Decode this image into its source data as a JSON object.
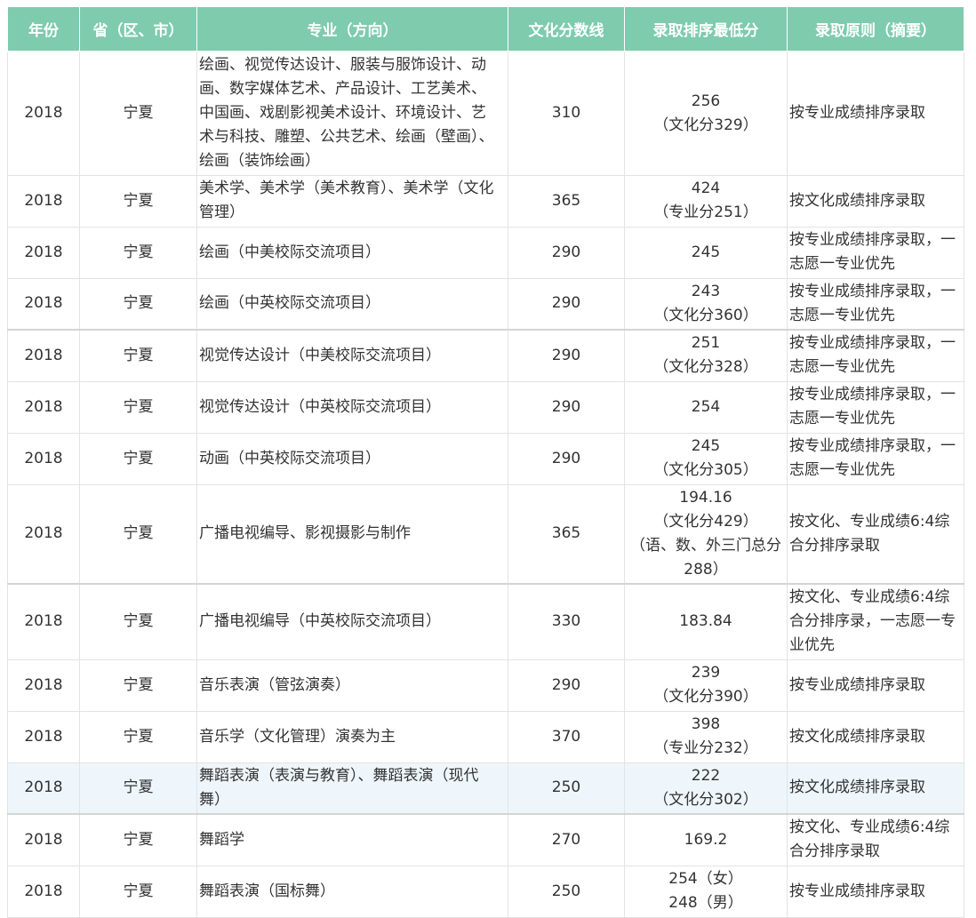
{
  "table": {
    "headers": [
      "年份",
      "省（区、市）",
      "专业（方向）",
      "文化分数线",
      "录取排序最低分",
      "录取原则（摘要）"
    ],
    "rows": [
      {
        "year": "2018",
        "province": "宁夏",
        "major": "绘画、视觉传达设计、服装与服饰设计、动画、数字媒体艺术、产品设计、工艺美术、中国画、戏剧影视美术设计、环境设计、艺术与科技、雕塑、公共艺术、绘画（壁画）、绘画（装饰绘画）",
        "culture_line": "310",
        "min_score": [
          "256",
          "（文化分329）"
        ],
        "principle": "按专业成绩排序录取"
      },
      {
        "year": "2018",
        "province": "宁夏",
        "major": "美术学、美术学（美术教育）、美术学（文化管理）",
        "culture_line": "365",
        "min_score": [
          "424",
          "（专业分251）"
        ],
        "principle": "按文化成绩排序录取"
      },
      {
        "year": "2018",
        "province": "宁夏",
        "major": "绘画（中美校际交流项目）",
        "culture_line": "290",
        "min_score": [
          "245"
        ],
        "principle": "按专业成绩排序录取，一志愿一专业优先"
      },
      {
        "year": "2018",
        "province": "宁夏",
        "major": "绘画（中英校际交流项目）",
        "culture_line": "290",
        "min_score": [
          "243",
          "（文化分360）"
        ],
        "principle": "按专业成绩排序录取，一志愿一专业优先"
      },
      {
        "year": "2018",
        "province": "宁夏",
        "major": "视觉传达设计（中美校际交流项目）",
        "culture_line": "290",
        "min_score": [
          "251",
          "（文化分328）"
        ],
        "principle": "按专业成绩排序录取，一志愿一专业优先"
      },
      {
        "year": "2018",
        "province": "宁夏",
        "major": "视觉传达设计（中英校际交流项目）",
        "culture_line": "290",
        "min_score": [
          "254"
        ],
        "principle": "按专业成绩排序录取，一志愿一专业优先"
      },
      {
        "year": "2018",
        "province": "宁夏",
        "major": "动画（中英校际交流项目）",
        "culture_line": "290",
        "min_score": [
          "245",
          "（文化分305）"
        ],
        "principle": "按专业成绩排序录取，一志愿一专业优先"
      },
      {
        "year": "2018",
        "province": "宁夏",
        "major": "广播电视编导、影视摄影与制作",
        "culture_line": "365",
        "min_score": [
          "194.16",
          "（文化分429）",
          "（语、数、外三门总分288）"
        ],
        "principle": "按文化、专业成绩6:4综合分排序录取"
      },
      {
        "year": "2018",
        "province": "宁夏",
        "major": "广播电视编导（中英校际交流项目）",
        "culture_line": "330",
        "min_score": [
          "183.84"
        ],
        "principle": "按文化、专业成绩6:4综合分排序录，一志愿一专业优先"
      },
      {
        "year": "2018",
        "province": "宁夏",
        "major": "音乐表演（管弦演奏）",
        "culture_line": "290",
        "min_score": [
          "239",
          "（文化分390）"
        ],
        "principle": "按专业成绩排序录取"
      },
      {
        "year": "2018",
        "province": "宁夏",
        "major": "音乐学（文化管理）演奏为主",
        "culture_line": "370",
        "min_score": [
          "398",
          "（专业分232）"
        ],
        "principle": "按文化成绩排序录取"
      },
      {
        "year": "2018",
        "province": "宁夏",
        "major": "舞蹈表演（表演与教育）、舞蹈表演（现代舞）",
        "culture_line": "250",
        "min_score": [
          "222",
          "（文化分302）"
        ],
        "principle": "按文化成绩排序录取"
      },
      {
        "year": "2018",
        "province": "宁夏",
        "major": "舞蹈学",
        "culture_line": "270",
        "min_score": [
          "169.2"
        ],
        "principle": "按文化、专业成绩6:4综合分排序录取"
      },
      {
        "year": "2018",
        "province": "宁夏",
        "major": "舞蹈表演（国标舞）",
        "culture_line": "250",
        "min_score": [
          "254（女）",
          "248（男）"
        ],
        "principle": "按专业成绩排序录取"
      }
    ]
  },
  "colors": {
    "header_bg": "#7ecbad",
    "header_text": "#ffffff",
    "highlight_row_bg": "#eef6fc",
    "border": "#e3e3e3"
  }
}
